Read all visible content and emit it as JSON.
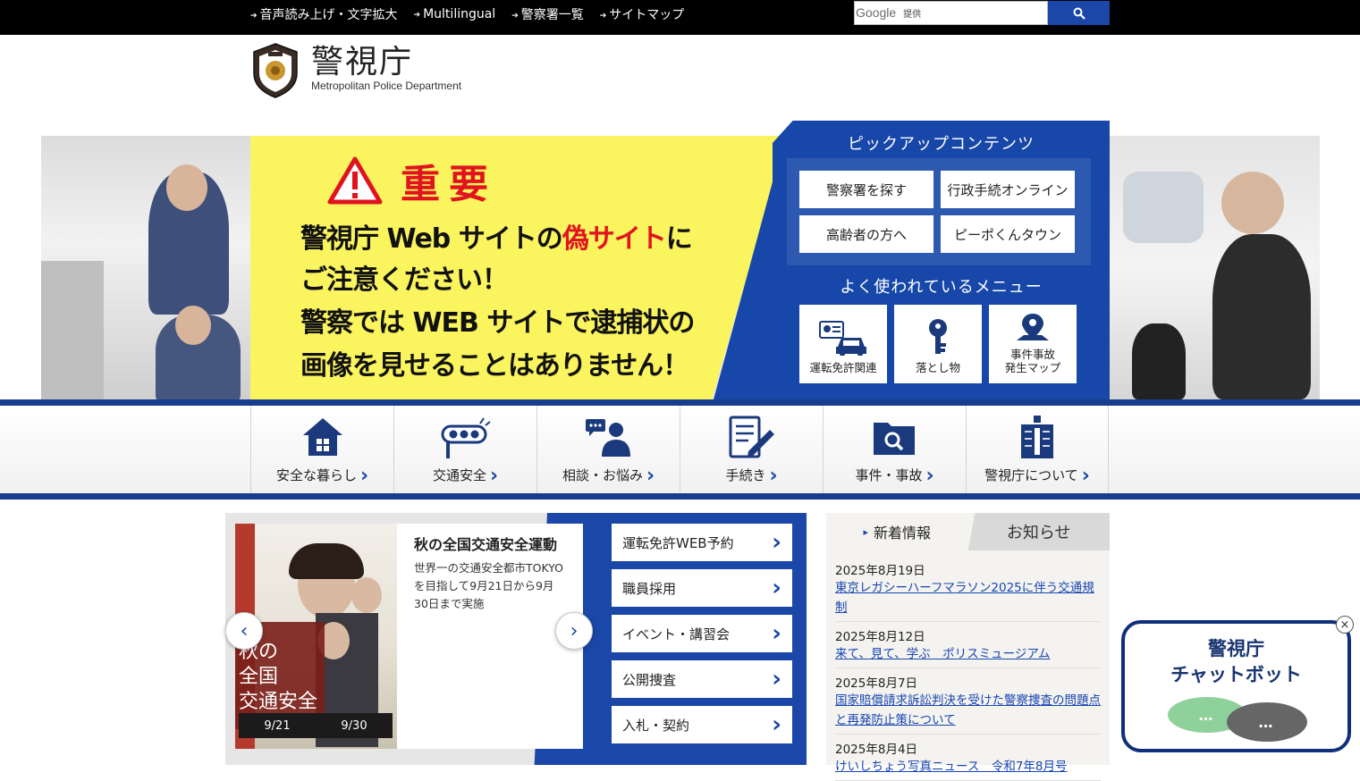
{
  "topbar": {
    "links": [
      "音声読み上げ・文字拡大",
      "Multilingual",
      "警察署一覧",
      "サイトマップ"
    ],
    "search_brand": "Google",
    "search_suffix": "提供"
  },
  "header": {
    "title": "警視庁",
    "subtitle": "Metropolitan Police Department"
  },
  "banner": {
    "important": "重要",
    "line1_a": "警視庁 Web サイトの",
    "line1_fake": "偽サイト",
    "line1_b": "に",
    "line2": "ご注意ください！",
    "line3": "警察では WEB サイトで逮捕状の",
    "line4": "画像を見せることはありません！"
  },
  "pickup": {
    "title": "ピックアップコンテンツ",
    "buttons": [
      "警察署を探す",
      "行政手続オンライン",
      "高齢者の方へ",
      "ピーポくんタウン"
    ],
    "menu_title": "よく使われているメニュー",
    "menu": [
      "運転免許関連",
      "落とし物",
      "事件事故\n発生マップ"
    ]
  },
  "mainnav": [
    "安全な暮らし",
    "交通安全",
    "相談・お悩み",
    "手続き",
    "事件・事故",
    "警視庁について"
  ],
  "slide": {
    "title": "秋の全国交通安全運動",
    "desc": "世界一の交通安全都市TOKYOを目指して9月21日から9月30日まで実施",
    "poster_text": "秋の\n全国\n交通安全\n運動",
    "poster_date1": "9/21",
    "poster_date2": "9/30"
  },
  "quick": [
    "運転免許WEB予約",
    "職員採用",
    "イベント・講習会",
    "公開捜査",
    "入札・契約"
  ],
  "news": {
    "tab_new": "新着情報",
    "tab_notice": "お知らせ",
    "items": [
      {
        "date": "2025年8月19日",
        "text": "東京レガシーハーフマラソン2025に伴う交通規制"
      },
      {
        "date": "2025年8月12日",
        "text": "来て、見て、学ぶ　ポリスミュージアム"
      },
      {
        "date": "2025年8月7日",
        "text": "国家賠償請求訴訟判決を受けた警察捜査の問題点と再発防止策について"
      },
      {
        "date": "2025年8月4日",
        "text": "けいしちょう写真ニュース　令和7年8月号"
      }
    ]
  },
  "chatbot": {
    "title_line1": "警視庁",
    "title_line2": "チャットボット",
    "close": "×",
    "bubble": "…"
  },
  "colors": {
    "brand": "#1a47a8",
    "navy": "#1a3c8c",
    "banner": "#faf45e",
    "alert": "#e0141e"
  }
}
